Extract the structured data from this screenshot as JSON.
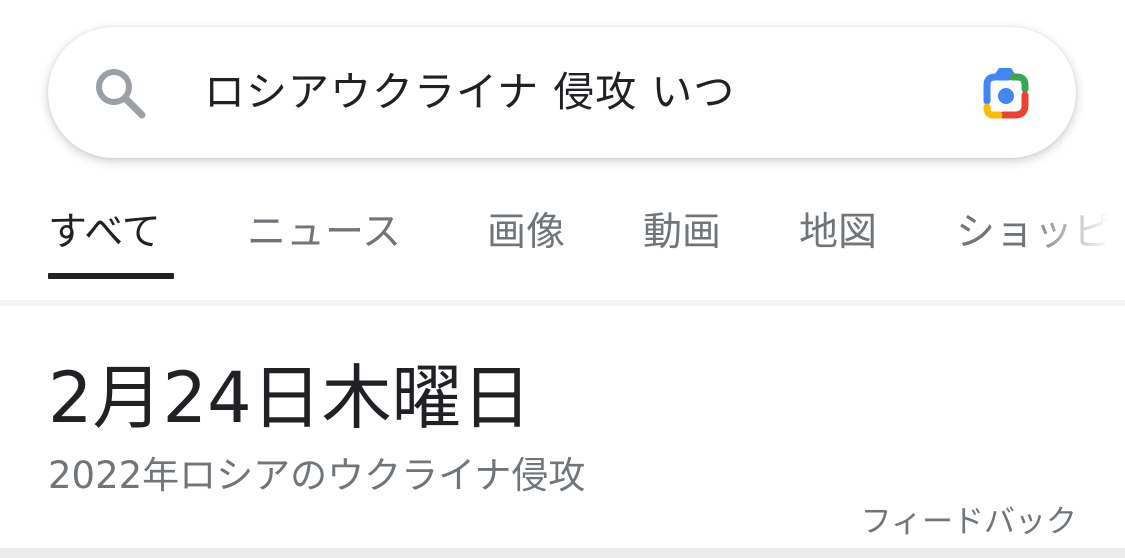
{
  "search": {
    "query": "ロシアウクライナ 侵攻 いつ",
    "search_icon": "search-icon",
    "lens_icon": "google-lens-icon"
  },
  "tabs": [
    {
      "label": "すべて",
      "active": true
    },
    {
      "label": "ニュース",
      "active": false
    },
    {
      "label": "画像",
      "active": false
    },
    {
      "label": "動画",
      "active": false
    },
    {
      "label": "地図",
      "active": false
    },
    {
      "label": "ショッピ",
      "active": false
    }
  ],
  "answer": {
    "date": "2月24日木曜日",
    "subtitle": "2022年ロシアのウクライナ侵攻",
    "feedback": "フィードバック"
  },
  "colors": {
    "text_primary": "#202124",
    "text_secondary": "#70757a",
    "lens_blue": "#4285f4",
    "lens_red": "#ea4335",
    "lens_yellow": "#fbbc04",
    "lens_green": "#34a853"
  }
}
